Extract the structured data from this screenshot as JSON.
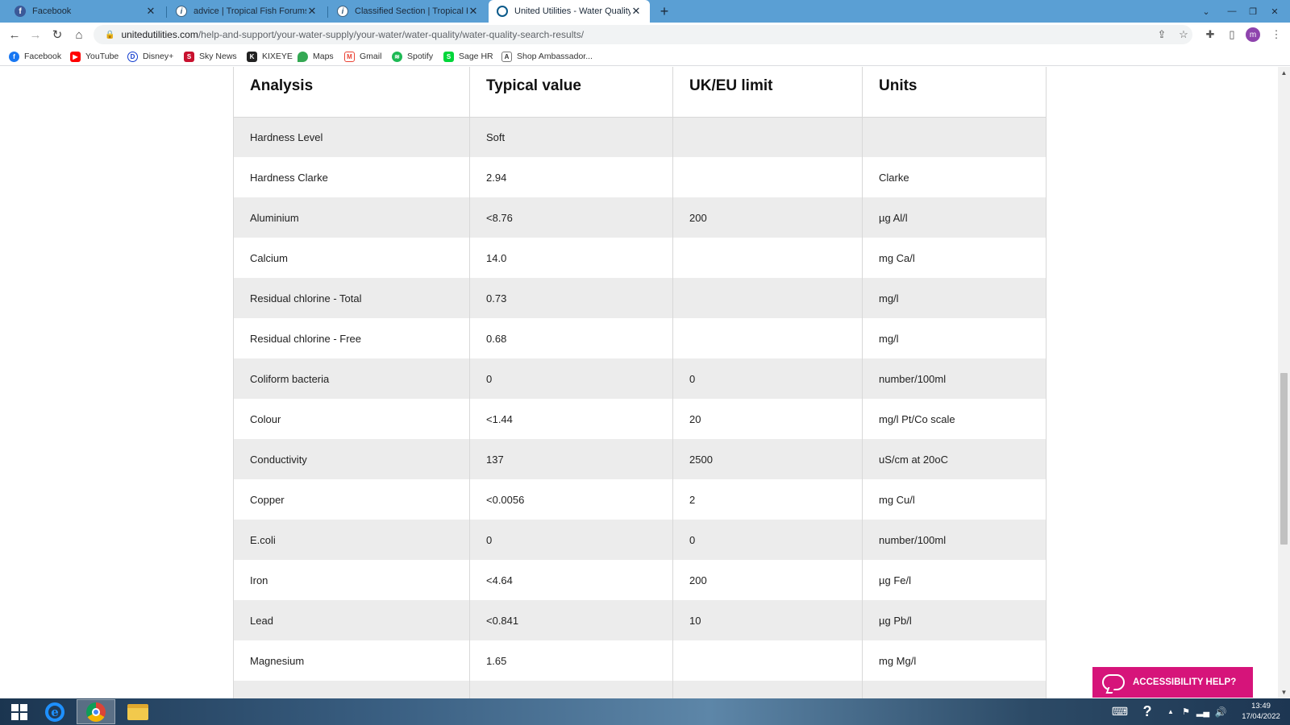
{
  "browser": {
    "tabs": [
      {
        "title": "Facebook",
        "active": false
      },
      {
        "title": "advice | Tropical Fish Forums",
        "active": false
      },
      {
        "title": "Classified Section | Tropical Fish F",
        "active": false
      },
      {
        "title": "United Utilities - Water Quality Se",
        "active": true
      }
    ],
    "url_host": "unitedutilities.com",
    "url_path": "/help-and-support/your-water-supply/your-water/water-quality/water-quality-search-results/",
    "profile_initial": "m",
    "bookmarks": [
      "Facebook",
      "YouTube",
      "Disney+",
      "Sky News",
      "KIXEYE",
      "Maps",
      "Gmail",
      "Spotify",
      "Sage HR",
      "Shop Ambassador..."
    ]
  },
  "table": {
    "headers": [
      "Analysis",
      "Typical value",
      "UK/EU limit",
      "Units"
    ],
    "rows": [
      [
        "Hardness Level",
        "Soft",
        "",
        ""
      ],
      [
        "Hardness Clarke",
        "2.94",
        "",
        "Clarke"
      ],
      [
        "Aluminium",
        "<8.76",
        "200",
        "µg Al/l"
      ],
      [
        "Calcium",
        "14.0",
        "",
        "mg Ca/l"
      ],
      [
        "Residual chlorine - Total",
        "0.73",
        "",
        "mg/l"
      ],
      [
        "Residual chlorine - Free",
        "0.68",
        "",
        "mg/l"
      ],
      [
        "Coliform bacteria",
        "0",
        "0",
        "number/100ml"
      ],
      [
        "Colour",
        "<1.44",
        "20",
        "mg/l Pt/Co scale"
      ],
      [
        "Conductivity",
        "137",
        "2500",
        "uS/cm at 20oC"
      ],
      [
        "Copper",
        "<0.0056",
        "2",
        "mg Cu/l"
      ],
      [
        "E.coli",
        "0",
        "0",
        "number/100ml"
      ],
      [
        "Iron",
        "<4.64",
        "200",
        "µg Fe/l"
      ],
      [
        "Lead",
        "<0.841",
        "10",
        "µg Pb/l"
      ],
      [
        "Magnesium",
        "1.65",
        "",
        "mg Mg/l"
      ],
      [
        "",
        "",
        "",
        ""
      ]
    ]
  },
  "accessibility_button": "ACCESSIBILITY HELP?",
  "taskbar": {
    "time": "13:49",
    "date": "17/04/2022"
  },
  "colors": {
    "tabbar": "#5a9fd4",
    "accessibility_pink": "#d6147a",
    "row_shade": "#ececec"
  }
}
